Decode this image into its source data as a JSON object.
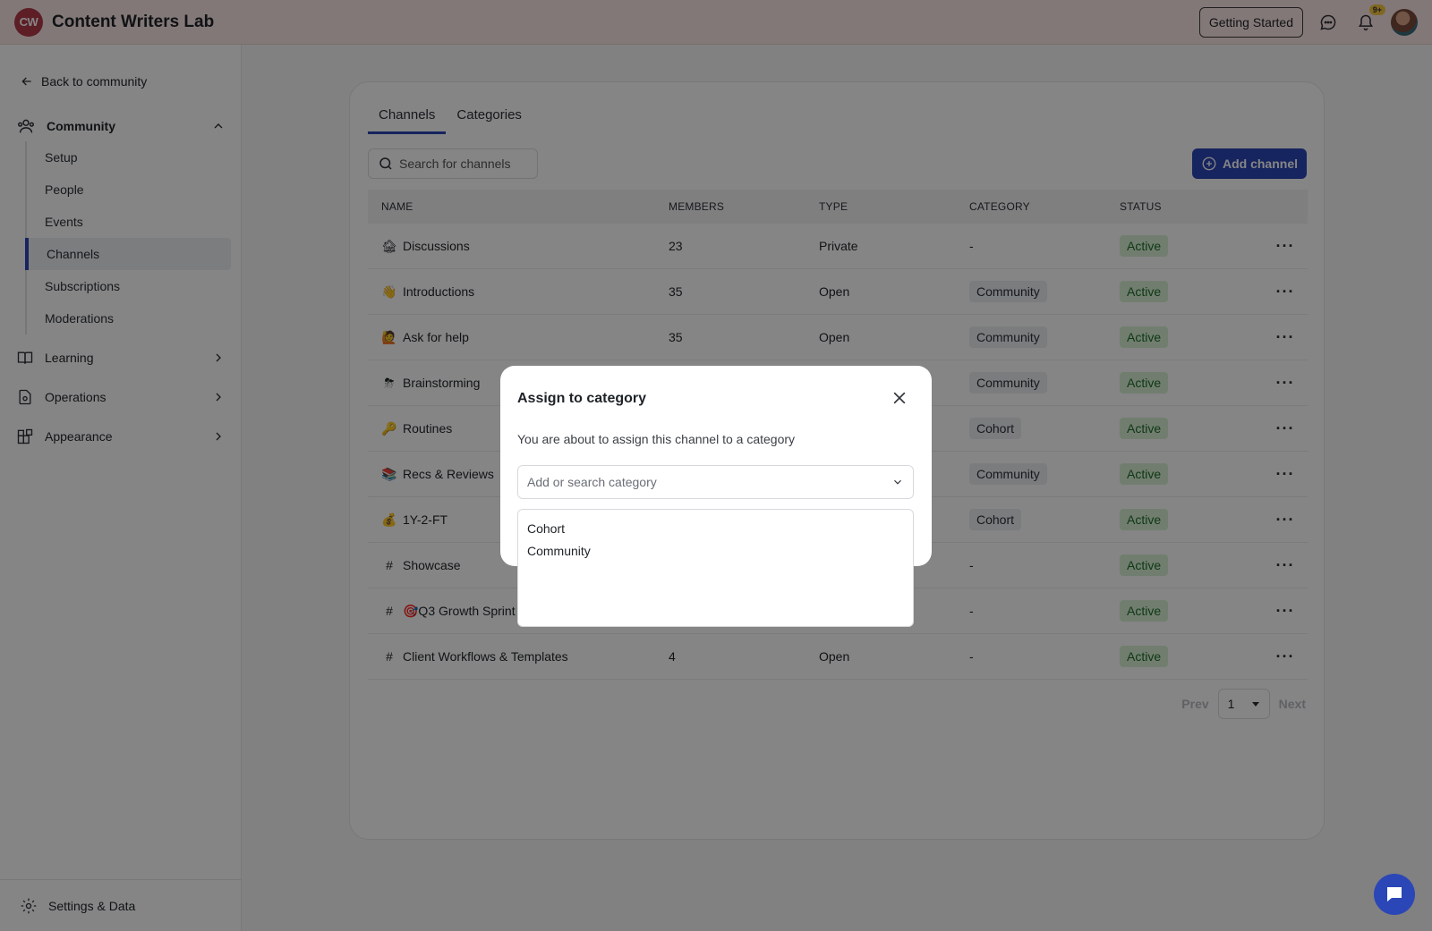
{
  "app": {
    "logo_text": "CW",
    "title": "Content Writers Lab"
  },
  "topbar": {
    "getting_started_label": "Getting Started",
    "notification_badge": "9+"
  },
  "sidebar": {
    "back_label": "Back to community",
    "community_label": "Community",
    "community_items": [
      "Setup",
      "People",
      "Events",
      "Channels",
      "Subscriptions",
      "Moderations"
    ],
    "active_item": "Channels",
    "learning_label": "Learning",
    "operations_label": "Operations",
    "appearance_label": "Appearance",
    "footer_label": "Settings & Data"
  },
  "main": {
    "tabs": [
      "Channels",
      "Categories"
    ],
    "active_tab": "Channels",
    "search_placeholder": "Search for channels",
    "add_channel_label": "Add channel",
    "columns": [
      "NAME",
      "MEMBERS",
      "TYPE",
      "CATEGORY",
      "STATUS"
    ],
    "rows": [
      {
        "icon": "🏚",
        "name": "Discussions",
        "members": "23",
        "type": "Private",
        "category": "-",
        "status": "Active"
      },
      {
        "icon": "👋",
        "name": "Introductions",
        "members": "35",
        "type": "Open",
        "category": "Community",
        "status": "Active"
      },
      {
        "icon": "🙋",
        "name": "Ask for help",
        "members": "35",
        "type": "Open",
        "category": "Community",
        "status": "Active"
      },
      {
        "icon": "⛈",
        "name": "Brainstorming",
        "members": "",
        "type": "",
        "category": "Community",
        "status": "Active"
      },
      {
        "icon": "🔑",
        "name": "Routines",
        "members": "",
        "type": "",
        "category": "Cohort",
        "status": "Active"
      },
      {
        "icon": "📚",
        "name": "Recs & Reviews",
        "members": "",
        "type": "",
        "category": "Community",
        "status": "Active"
      },
      {
        "icon": "💰",
        "name": "1Y-2-FT",
        "members": "",
        "type": "",
        "category": "Cohort",
        "status": "Active"
      },
      {
        "icon": "#",
        "name": "Showcase",
        "members": "",
        "type": "",
        "category": "-",
        "status": "Active"
      },
      {
        "icon": "#",
        "name": "🎯Q3 Growth Sprint",
        "members": "",
        "type": "",
        "category": "-",
        "status": "Active"
      },
      {
        "icon": "#",
        "name": "Client Workflows & Templates",
        "members": "4",
        "type": "Open",
        "category": "-",
        "status": "Active"
      }
    ],
    "pager": {
      "prev": "Prev",
      "page": "1",
      "next": "Next"
    }
  },
  "modal": {
    "title": "Assign to category",
    "description": "You are about to assign this channel to a category",
    "input_placeholder": "Add or search category",
    "options": [
      "Cohort",
      "Community"
    ]
  },
  "colors": {
    "topbar_bg": "#fbe7e7",
    "accent": "#2b46b7",
    "status_bg": "#d8f2d5",
    "logo_bg": "#b23a4a"
  }
}
